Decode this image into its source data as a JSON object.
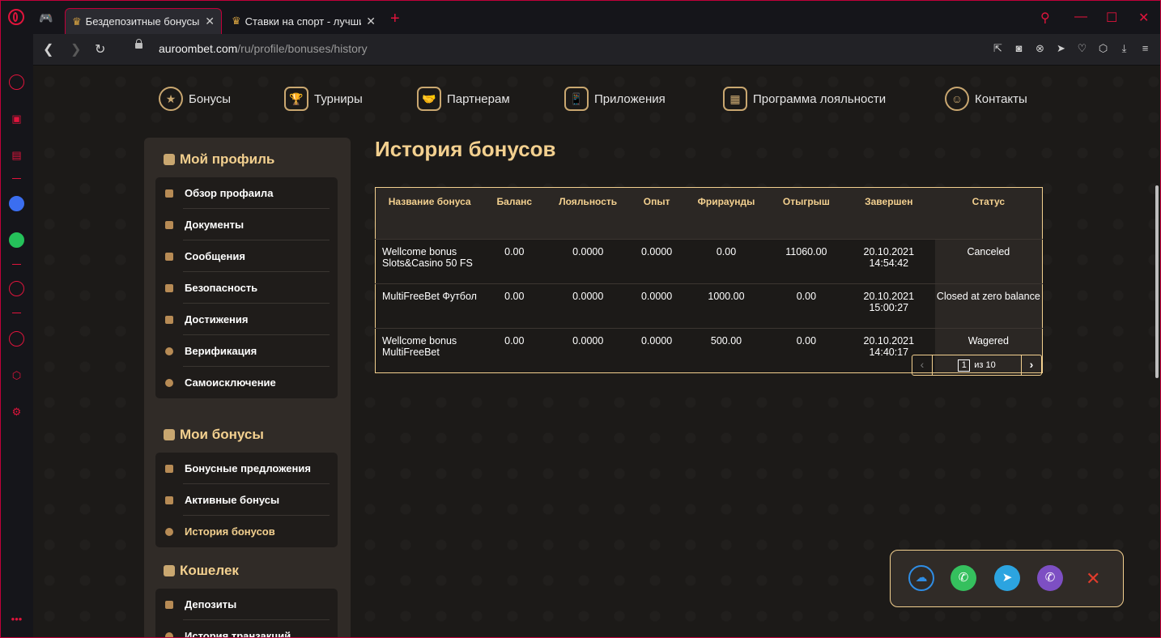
{
  "browser": {
    "tabs": [
      {
        "title": "Бездепозитные бонусы в ..."
      },
      {
        "title": "Ставки на спорт - лучшие ..."
      }
    ],
    "address": {
      "host": "auroombet.com",
      "path": "/ru/profile/bonuses/history"
    }
  },
  "topnav": [
    {
      "label": "Бонусы",
      "icon": "coin-icon"
    },
    {
      "label": "Турниры",
      "icon": "trophy-icon"
    },
    {
      "label": "Партнерам",
      "icon": "handshake-icon"
    },
    {
      "label": "Приложения",
      "icon": "phone-hand-icon"
    },
    {
      "label": "Программа лояльности",
      "icon": "loyalty-card-icon"
    },
    {
      "label": "Контакты",
      "icon": "support-agent-icon"
    }
  ],
  "profile": {
    "title": "Мой профиль",
    "items": [
      "Обзор профаила",
      "Документы",
      "Сообщения",
      "Безопасность",
      "Достижения",
      "Верификация",
      "Самоисключение"
    ]
  },
  "bonuses": {
    "title": "Мои бонусы",
    "items": [
      "Бонусные предложения",
      "Активные бонусы",
      "История бонусов"
    ]
  },
  "wallet": {
    "title": "Кошелек",
    "items": [
      "Депозиты",
      "История транзакций"
    ]
  },
  "main": {
    "title": "История бонусов",
    "table": {
      "headers": [
        "Название бонуса",
        "Баланс",
        "Лояльность",
        "Опыт",
        "Фрираунды",
        "Отыгрыш",
        "Завершен",
        "Статус"
      ],
      "rows": [
        [
          "Wellcome bonus Slots&Casino 50 FS",
          "0.00",
          "0.0000",
          "0.0000",
          "0.00",
          "11060.00",
          "20.10.2021 14:54:42",
          "Canceled"
        ],
        [
          "MultiFreeBet Футбол",
          "0.00",
          "0.0000",
          "0.0000",
          "1000.00",
          "0.00",
          "20.10.2021 15:00:27",
          "Closed at zero balance"
        ],
        [
          "Wellcome bonus MultiFreeBet",
          "0.00",
          "0.0000",
          "0.0000",
          "500.00",
          "0.00",
          "20.10.2021 14:40:17",
          "Wagered"
        ]
      ]
    },
    "pager": {
      "current": "1",
      "of_label": "из 10"
    }
  },
  "colors": {
    "accent": "#f3d08f",
    "brand_red": "#e0143c",
    "bg": "#1c1a18"
  }
}
